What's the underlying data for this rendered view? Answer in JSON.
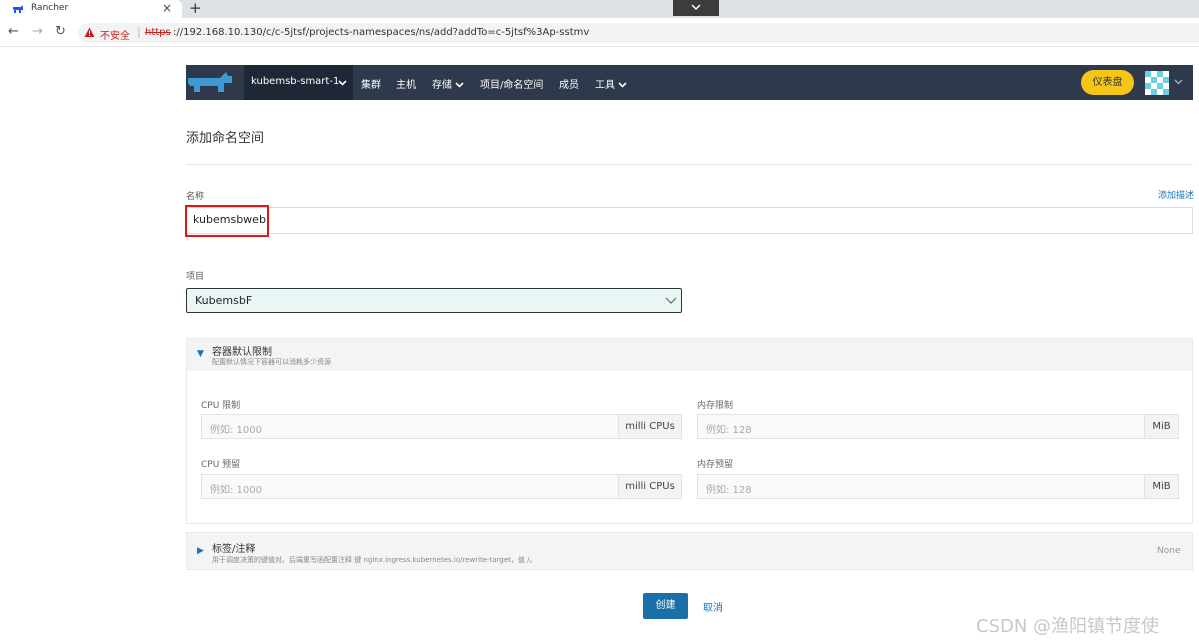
{
  "browser": {
    "tab_title": "Rancher",
    "tab_close": "×",
    "new_tab": "+",
    "back": "←",
    "forward": "→",
    "reload": "↻",
    "insecure_label": "不安全",
    "separator": "|",
    "url_scheme": "https",
    "url_rest": "://192.168.10.130/c/c-5jtsf/projects-namespaces/ns/add?addTo=c-5jtsf%3Ap-sstmv"
  },
  "header": {
    "cluster": "kubemsb-smart-1",
    "nav": [
      "集群",
      "主机",
      "存储",
      "项目/命名空间",
      "成员",
      "工具"
    ],
    "dashboard": "仪表盘"
  },
  "page": {
    "title": "添加命名空间",
    "name_label": "名称",
    "add_description": "添加描述",
    "name_value": "kubemsbweb",
    "project_label": "项目",
    "project_value": "KubemsbF"
  },
  "limits": {
    "title": "容器默认限制",
    "subtitle": "配置默认情况下容器可以消耗多少资源",
    "cpu_limit_label": "CPU 限制",
    "cpu_limit_placeholder": "例如: 1000",
    "cpu_limit_unit": "milli CPUs",
    "mem_limit_label": "内存限制",
    "mem_limit_placeholder": "例如: 128",
    "mem_limit_unit": "MiB",
    "cpu_reserve_label": "CPU 预留",
    "cpu_reserve_placeholder": "例如: 1000",
    "cpu_reserve_unit": "milli CPUs",
    "mem_reserve_label": "内存预留",
    "mem_reserve_placeholder": "例如: 128",
    "mem_reserve_unit": "MiB"
  },
  "labels": {
    "title": "标签/注释",
    "hint": "用于调度决策的键值对。后端重写函配置注释 键 nginx.ingress.kubernetes.io/rewrite-target，值 /。",
    "status": "None"
  },
  "actions": {
    "create": "创建",
    "cancel": "取消"
  },
  "watermark": "CSDN @渔阳镇节度使",
  "colors": {
    "header_bg": "#2e3a4c",
    "accent": "#1a6fa8",
    "dashboard_button": "#f5c518",
    "highlight_box": "#d91a1a"
  }
}
